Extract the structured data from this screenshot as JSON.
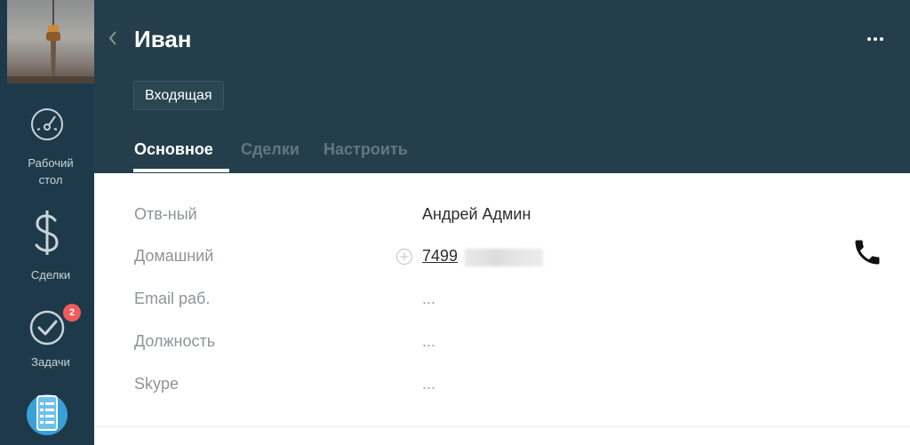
{
  "sidebar": {
    "items": [
      {
        "label_line1": "Рабочий",
        "label_line2": "стол",
        "icon": "dashboard-gauge-icon"
      },
      {
        "label_line1": "Сделки",
        "icon": "dollar-icon"
      },
      {
        "label_line1": "Задачи",
        "icon": "checkmark-circle-icon",
        "badge": "2"
      },
      {
        "icon": "list-icon"
      }
    ]
  },
  "header": {
    "title": "Иван",
    "status": "Входящая",
    "tabs": [
      "Основное",
      "Сделки",
      "Настроить"
    ]
  },
  "fields": [
    {
      "label": "Отв-ный",
      "value": "Андрей Админ"
    },
    {
      "label": "Домашний",
      "value": "7499"
    },
    {
      "label": "Email раб.",
      "value": "..."
    },
    {
      "label": "Должность",
      "value": "..."
    },
    {
      "label": "Skype",
      "value": "..."
    }
  ],
  "colors": {
    "sidebar_bg": "#1e3a4a",
    "header_bg": "#243f4b",
    "badge_red": "#ef5b5b",
    "accent_blue": "#3aa0d8"
  }
}
